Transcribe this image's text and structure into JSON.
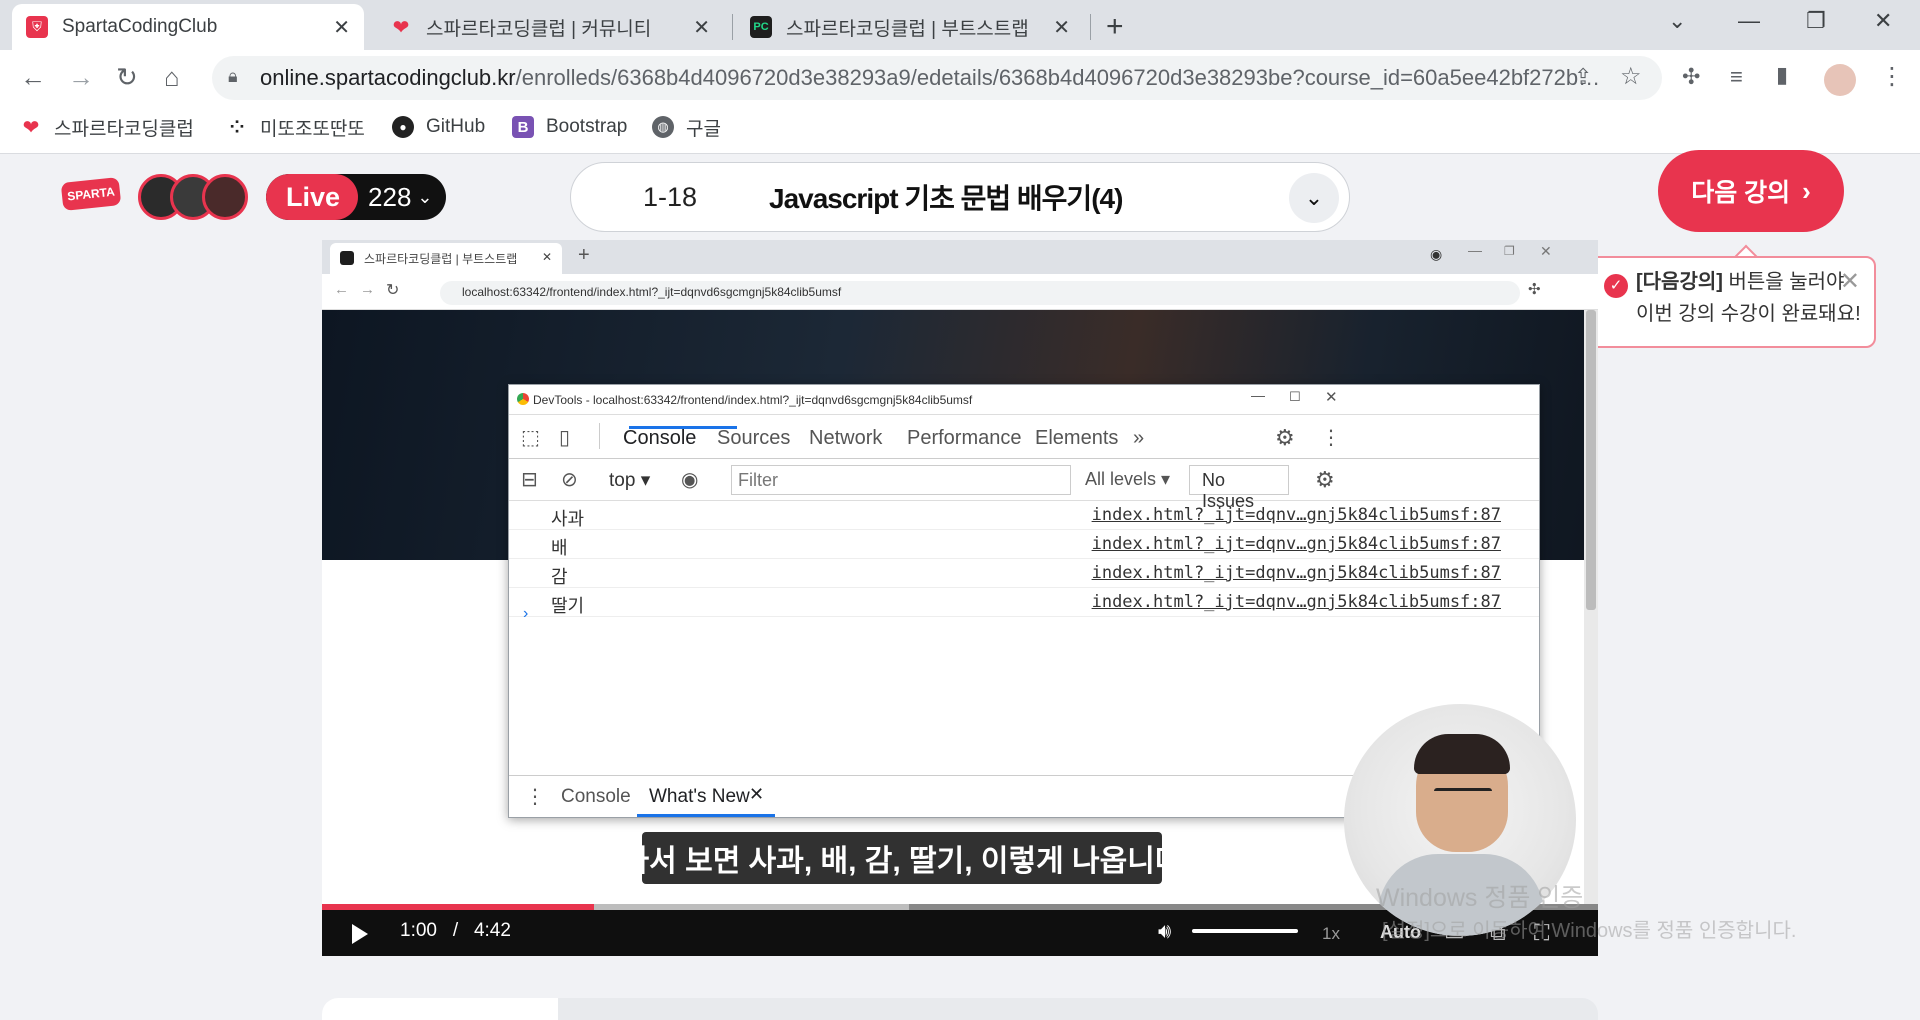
{
  "browser": {
    "tabs": [
      {
        "title": "SpartaCodingClub"
      },
      {
        "title": "스파르타코딩클럽 | 커뮤니티"
      },
      {
        "title": "스파르타코딩클럽 | 부트스트랩"
      }
    ],
    "url_host": "online.spartacodingclub.kr",
    "url_path": "/enrolleds/6368b4d4096720d3e38293a9/edetails/6368b4d4096720d3e38293be?course_id=60a5ee42bf272b…",
    "bookmarks": [
      {
        "label": "스파르타코딩클럽",
        "icon": "sparta-icon"
      },
      {
        "label": "미또조또딴또",
        "icon": "dots-icon"
      },
      {
        "label": "GitHub",
        "icon": "github-icon"
      },
      {
        "label": "Bootstrap",
        "icon": "bootstrap-icon"
      },
      {
        "label": "구글",
        "icon": "globe-icon"
      }
    ]
  },
  "header": {
    "logo_text": "SPARTA",
    "live_label": "Live",
    "live_count": "228",
    "lecture_number": "1-18",
    "lecture_title": "Javascript 기초 문법 배우기(4)",
    "next_button": "다음 강의",
    "tooltip": {
      "bold": "[다음강의]",
      "line1": " 버튼을 눌러야",
      "line2": "이번 강의 수강이 완료돼요!"
    }
  },
  "video": {
    "inner_tab": "스파르타코딩클럽 | 부트스트랩",
    "inner_url": "localhost:63342/frontend/index.html?_ijt=dqnvd6sgcmgnj5k84clib5umsf",
    "devtools": {
      "title": "DevTools - localhost:63342/frontend/index.html?_ijt=dqnvd6sgcmgnj5k84clib5umsf",
      "tabs": [
        "Console",
        "Sources",
        "Network",
        "Performance",
        "Elements"
      ],
      "context": "top",
      "filter_placeholder": "Filter",
      "levels": "All levels",
      "issues": "No Issues",
      "log_lines": [
        {
          "value": "사과",
          "source": "index.html?_ijt=dqnv…gnj5k84clib5umsf:87"
        },
        {
          "value": "배",
          "source": "index.html?_ijt=dqnv…gnj5k84clib5umsf:87"
        },
        {
          "value": "감",
          "source": "index.html?_ijt=dqnv…gnj5k84clib5umsf:87"
        },
        {
          "value": "딸기",
          "source": "index.html?_ijt=dqnv…gnj5k84clib5umsf:87"
        }
      ],
      "drawer_tabs": [
        "Console",
        "What's New"
      ]
    },
    "subtitle": "가서 보면 사과, 배, 감, 딸기, 이렇게 나옵니다",
    "current_time": "1:00",
    "duration": "4:42",
    "progress_fraction": 0.213,
    "buffered_fraction": 0.46,
    "speed": "1x",
    "quality": "Auto"
  },
  "watermark": {
    "line1": "Windows 정품 인증",
    "line2": "[설정]으로 이동하여 Windows를 정품 인증합니다."
  },
  "colors": {
    "brand": "#e8344e",
    "devtools_accent": "#1a73e8"
  }
}
